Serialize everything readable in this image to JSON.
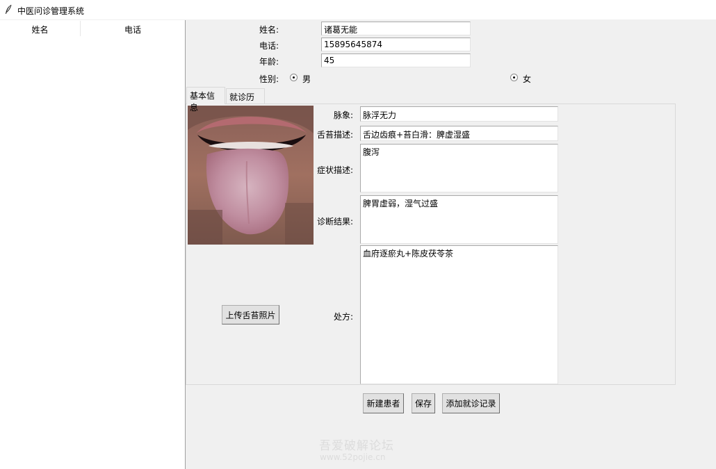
{
  "window": {
    "title": "中医问诊管理系统",
    "icon": "feather-icon"
  },
  "patient_list": {
    "columns": [
      "姓名",
      "电话"
    ],
    "rows": []
  },
  "patient": {
    "name_label": "姓名:",
    "name_value": "诸葛无能",
    "phone_label": "电话:",
    "phone_value": "15895645874",
    "age_label": "年龄:",
    "age_value": "45",
    "gender_label": "性别:",
    "gender_male": "男",
    "gender_female": "女"
  },
  "tabs": [
    {
      "label": "基本信息",
      "active": true
    },
    {
      "label": "就诊历史",
      "active": false
    }
  ],
  "diagnosis": {
    "pulse_label": "脉象:",
    "pulse_value": "脉浮无力",
    "tongue_label": "舌苔描述:",
    "tongue_value": "舌边齿痕+苔白滑：脾虚湿盛",
    "symptom_label": "症状描述:",
    "symptom_value": "腹泻",
    "result_label": "诊断结果:",
    "result_value": "脾胃虚弱，湿气过盛",
    "prescription_label": "处方:",
    "prescription_value": "血府逐瘀丸+陈皮茯苓茶",
    "upload_button": "上传舌苔照片"
  },
  "actions": {
    "new_patient": "新建患者",
    "save": "保存",
    "add_record": "添加就诊记录"
  },
  "watermark": {
    "line1": "吾爱破解论坛",
    "line2": "www.52pojie.cn"
  }
}
